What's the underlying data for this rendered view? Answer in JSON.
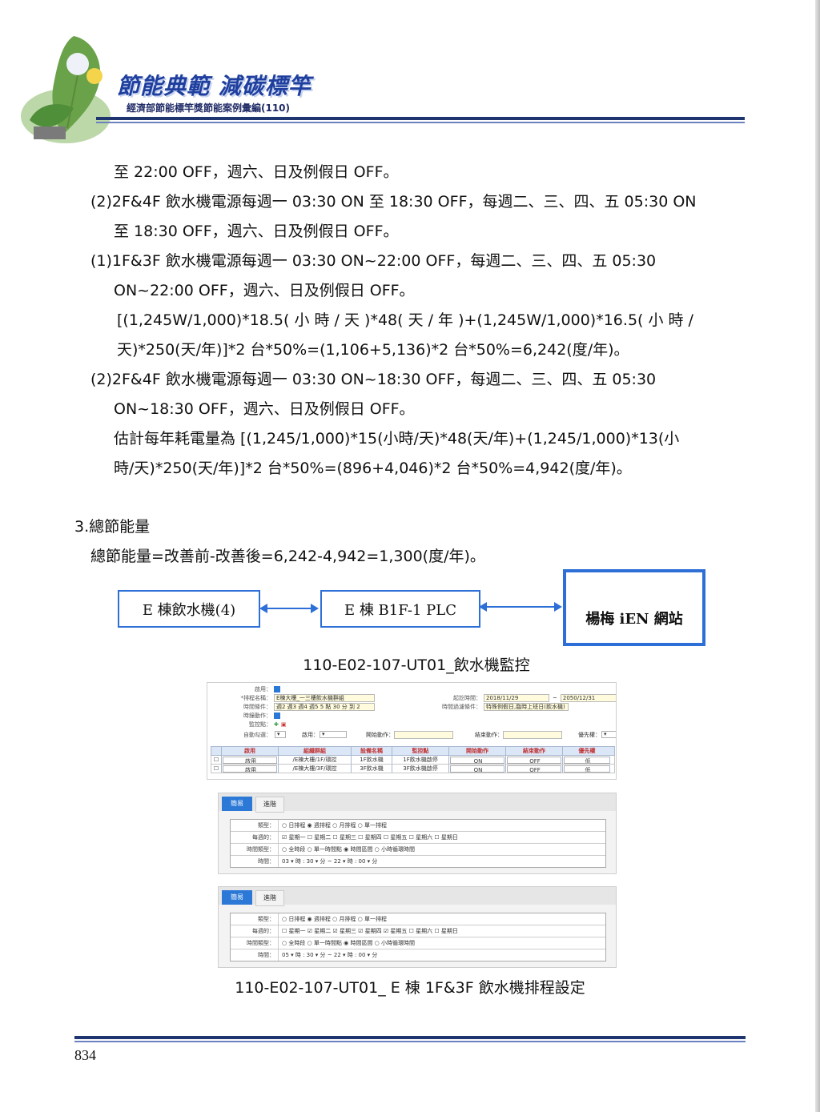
{
  "header": {
    "title": "節能典範 減碳標竿",
    "subtitle": "經濟部節能標竿獎節能案例彙編(110)"
  },
  "body": {
    "l1": "至 22:00 OFF，週六、日及例假日 OFF。",
    "l2": "(2)2F&4F 飲水機電源每週一 03:30 ON 至 18:30 OFF，每週二、三、四、五 05:30 ON",
    "l3": "至 18:30 OFF，週六、日及例假日 OFF。",
    "l4a": "(1)1F&3F 飲水機電源每週一 03:30 ON~22:00 OFF，每週二、三、四、五 05:30",
    "l5": "ON~22:00 OFF，週六、日及例假日 OFF。",
    "l6": "[(1,245W/1,000)*18.5( 小 時 / 天 )*48( 天 / 年 )+(1,245W/1,000)*16.5( 小 時 /",
    "l7": "天)*250(天/年)]*2 台*50%=(1,106+5,136)*2 台*50%=6,242(度/年)。",
    "l8": "(2)2F&4F 飲水機電源每週一 03:30 ON~18:30 OFF，每週二、三、四、五 05:30",
    "l9": "ON~18:30 OFF，週六、日及例假日 OFF。",
    "l10": "估計每年耗電量為 [(1,245/1,000)*15(小時/天)*48(天/年)+(1,245/1,000)*13(小",
    "l11": "時/天)*250(天/年)]*2 台*50%=(896+4,046)*2 台*50%=4,942(度/年)。",
    "section_title": "3.總節能量",
    "total": "總節能量=改善前-改善後=6,242-4,942=1,300(度/年)。"
  },
  "diagram": {
    "box1": "E 棟飲水機(4)",
    "box2": "E 棟 B1F-1 PLC",
    "box3": "楊梅 iEN 網站",
    "caption": "110-E02-107-UT01_飲水機監控"
  },
  "screen": {
    "f_enable": "啟用：",
    "f_name": "*排程名稱：",
    "f_name_val": "E棟大樓_一三樓飲水機群組",
    "f_period": "起訖時間：",
    "f_start": "2018/11/29",
    "f_end": "2050/12/31",
    "f_cond": "時間條件：",
    "f_cond_val": "週2 週3 週4 週5 5 點 30 分 到 2",
    "f_filter": "時間過濾條件：",
    "f_filter_val": "特殊例假日,臨時上班日(飲水機)",
    "f_action": "時鐘動作：",
    "f_monitor": "監控點：",
    "f_auto": "自動勾選：",
    "f_en2": "啟用：",
    "f_start_act": "開始動作：",
    "f_end_act": "結束動作：",
    "f_priority": "優先權：",
    "cols": [
      "",
      "啟用",
      "組織群組",
      "設備名稱",
      "監控點",
      "開始動作",
      "結束動作",
      "優先權"
    ],
    "rows": [
      [
        "啟用",
        "/E棟大樓/1F/環控",
        "1F飲水機",
        "1F飲水機啟停",
        "ON",
        "OFF",
        "低"
      ],
      [
        "啟用",
        "/E棟大樓/3F/環控",
        "3F飲水機",
        "3F飲水機啟停",
        "ON",
        "OFF",
        "低"
      ]
    ],
    "tab_simple": "簡易",
    "tab_advanced": "進階",
    "g_type": "類型：",
    "g_type_val": "○ 日排程 ◉ 週排程 ○ 月排程 ○ 單一排程",
    "g_week": "每週的：",
    "g_week_a": "☑ 星期一 ☐ 星期二 ☐ 星期三 ☐ 星期四 ☐ 星期五 ☐ 星期六 ☐ 星期日",
    "g_week_b": "☐ 星期一 ☑ 星期二 ☑ 星期三 ☑ 星期四 ☑ 星期五 ☐ 星期六 ☐ 星期日",
    "g_ttype": "時間類型：",
    "g_ttype_val": "○ 全時段 ○ 單一時間點 ◉ 時間區間 ○ 小時循環時間",
    "g_time": "時間：",
    "g_time_a": "03 ▾ 時 : 30 ▾ 分 ~ 22 ▾ 時 : 00 ▾ 分",
    "g_time_b": "05 ▾ 時 : 30 ▾ 分 ~ 22 ▾ 時 : 00 ▾ 分",
    "caption": "110-E02-107-UT01_ E 棟 1F&3F 飲水機排程設定"
  },
  "footer": {
    "page": "834"
  }
}
